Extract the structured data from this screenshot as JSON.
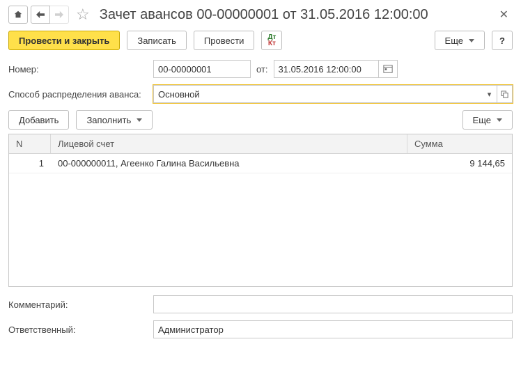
{
  "title": "Зачет авансов 00-00000001 от 31.05.2016 12:00:00",
  "toolbar": {
    "post_close": "Провести и закрыть",
    "save": "Записать",
    "post": "Провести",
    "more": "Еще",
    "help": "?"
  },
  "fields": {
    "number_label": "Номер:",
    "number_value": "00-00000001",
    "from_label": "от:",
    "date_value": "31.05.2016 12:00:00",
    "method_label": "Способ распределения аванса:",
    "method_value": "Основной"
  },
  "table_toolbar": {
    "add": "Добавить",
    "fill": "Заполнить",
    "more": "Еще"
  },
  "table": {
    "headers": {
      "n": "N",
      "account": "Лицевой счет",
      "sum": "Сумма"
    },
    "rows": [
      {
        "n": "1",
        "account": "00-000000011, Агеенко Галина Васильевна",
        "sum": "9 144,65"
      }
    ]
  },
  "bottom": {
    "comment_label": "Комментарий:",
    "comment_value": "",
    "responsible_label": "Ответственный:",
    "responsible_value": "Администратор"
  }
}
